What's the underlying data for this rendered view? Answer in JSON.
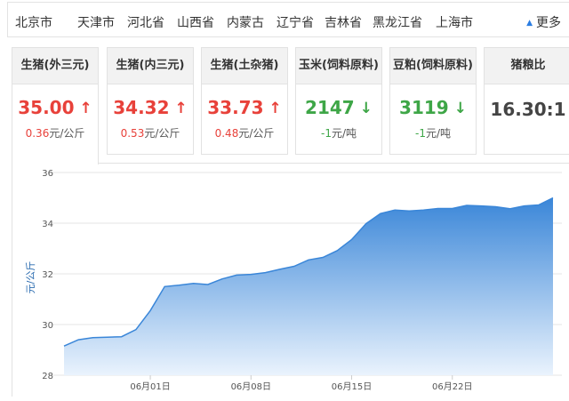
{
  "provinces": [
    "北京市",
    "天津市",
    "河北省",
    "山西省",
    "内蒙古",
    "辽宁省",
    "吉林省",
    "黑龙江省",
    "上海市"
  ],
  "more_label": "更多",
  "cards": [
    {
      "title": "生猪(外三元)",
      "price": "35.00",
      "arrow": "↑",
      "change": "0.36",
      "unit": "元/公斤",
      "trend": "up"
    },
    {
      "title": "生猪(内三元)",
      "price": "34.32",
      "arrow": "↑",
      "change": "0.53",
      "unit": "元/公斤",
      "trend": "up"
    },
    {
      "title": "生猪(土杂猪)",
      "price": "33.73",
      "arrow": "↑",
      "change": "0.48",
      "unit": "元/公斤",
      "trend": "up"
    },
    {
      "title": "玉米(饲料原料)",
      "price": "2147",
      "arrow": "↓",
      "change": "-1",
      "unit": "元/吨",
      "trend": "down"
    },
    {
      "title": "豆粕(饲料原料)",
      "price": "3119",
      "arrow": "↓",
      "change": "-1",
      "unit": "元/吨",
      "trend": "down"
    },
    {
      "title": "猪粮比",
      "price": "16.30:1",
      "arrow": "",
      "change": "",
      "unit": "",
      "trend": "none"
    }
  ],
  "colors": {
    "up": "#e8413a",
    "down": "#3ea647",
    "area_top": "#3a86d8",
    "area_bottom": "#eaf3fd",
    "line": "#3a86d8",
    "axis_text": "#555"
  },
  "chart_data": {
    "type": "area",
    "ylabel": "元/公斤",
    "ylim": [
      28,
      36
    ],
    "yticks": [
      28,
      30,
      32,
      34,
      36
    ],
    "xtick_labels": [
      {
        "day": 6,
        "label": "06月01日"
      },
      {
        "day": 13,
        "label": "06月08日"
      },
      {
        "day": 20,
        "label": "06月15日"
      },
      {
        "day": 27,
        "label": "06月22日"
      }
    ],
    "x_days": [
      0,
      1,
      2,
      3,
      4,
      5,
      6,
      7,
      8,
      9,
      10,
      11,
      12,
      13,
      14,
      15,
      16,
      17,
      18,
      19,
      20,
      21,
      22,
      23,
      24,
      25,
      26,
      27,
      28,
      29,
      30,
      31,
      32,
      33,
      34
    ],
    "values": [
      29.15,
      29.4,
      29.48,
      29.5,
      29.52,
      29.8,
      30.55,
      31.5,
      31.55,
      31.62,
      31.58,
      31.8,
      31.95,
      31.98,
      32.05,
      32.18,
      32.3,
      32.55,
      32.65,
      32.92,
      33.35,
      33.98,
      34.38,
      34.52,
      34.48,
      34.52,
      34.58,
      34.58,
      34.7,
      34.68,
      34.65,
      34.57,
      34.68,
      34.72,
      35.0
    ],
    "grid": true
  }
}
